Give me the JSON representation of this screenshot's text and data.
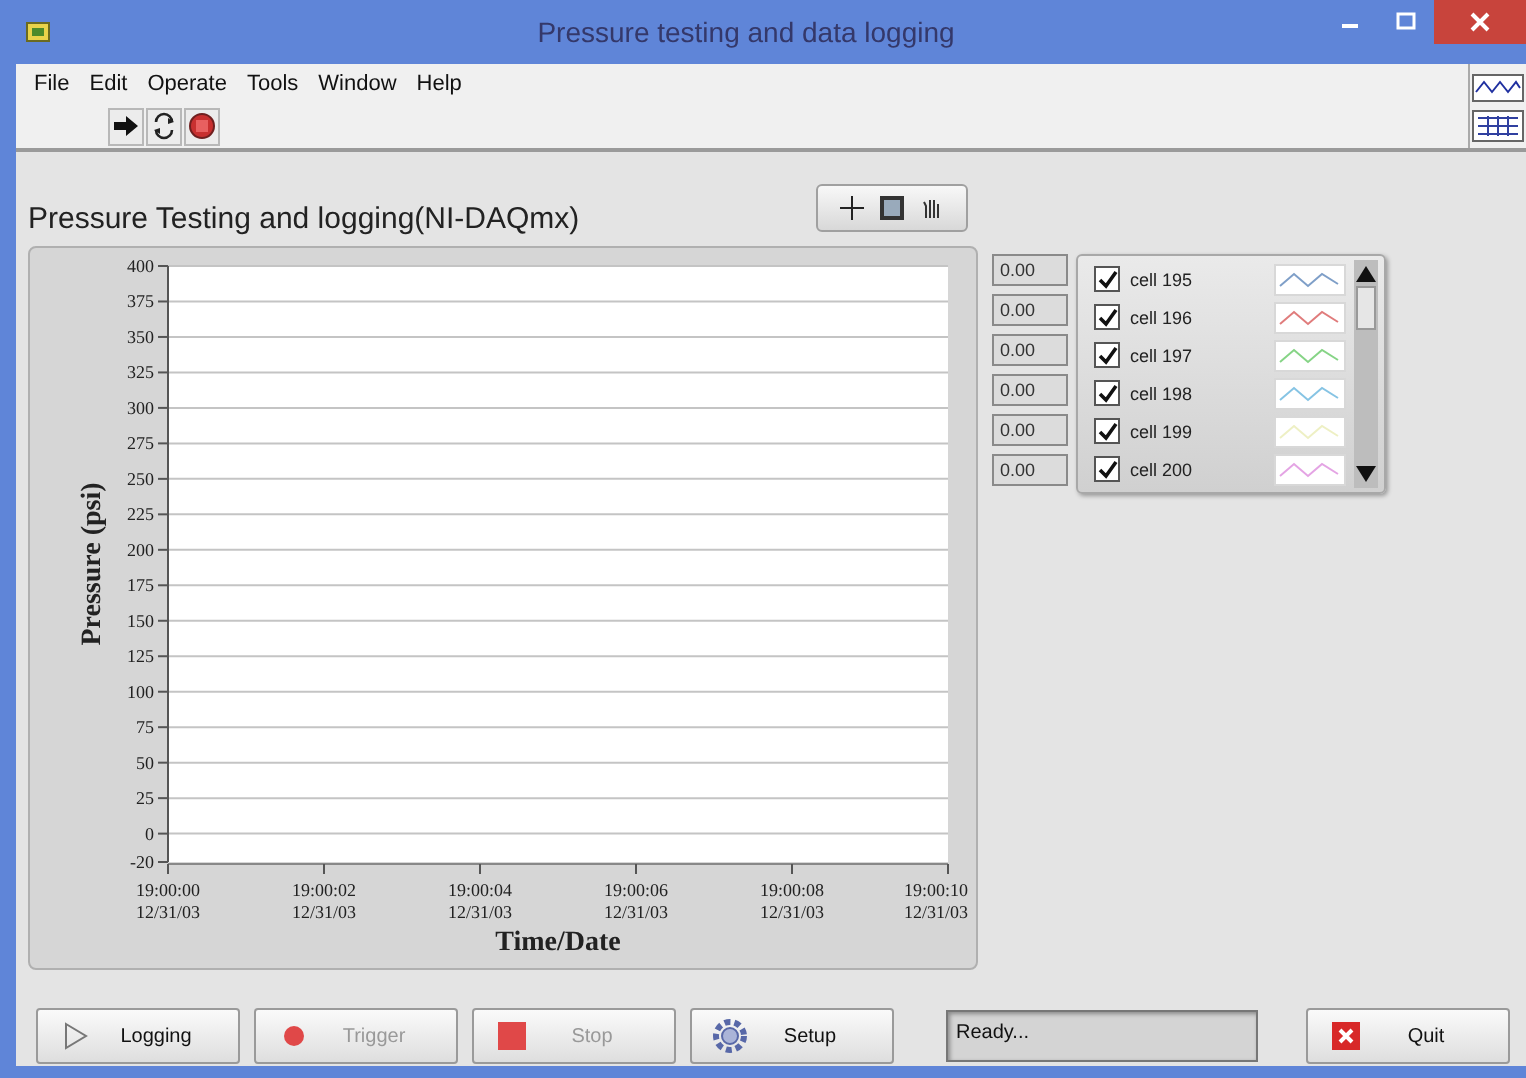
{
  "window": {
    "title": "Pressure testing and data logging"
  },
  "menu": [
    "File",
    "Edit",
    "Operate",
    "Tools",
    "Window",
    "Help"
  ],
  "panel_title": "Pressure Testing and logging(NI-DAQmx)",
  "graph": {
    "chart_data": {
      "type": "line",
      "grid": true,
      "xlabel": "Time/Date",
      "ylabel": "Pressure (psi)",
      "ylim": [
        -20,
        400
      ],
      "yticks": [
        -20,
        0,
        25,
        50,
        75,
        100,
        125,
        150,
        175,
        200,
        225,
        250,
        275,
        300,
        325,
        350,
        375,
        400
      ],
      "categories": [
        "19:00:00 12/31/03",
        "19:00:02 12/31/03",
        "19:00:04 12/31/03",
        "19:00:06 12/31/03",
        "19:00:08 12/31/03",
        "19:00:10 12/31/03"
      ]
    }
  },
  "legend": [
    {
      "name": "cell 195",
      "checked": true,
      "color": "#7f9fc8",
      "value": "0.00"
    },
    {
      "name": "cell 196",
      "checked": true,
      "color": "#e07c7c",
      "value": "0.00"
    },
    {
      "name": "cell 197",
      "checked": true,
      "color": "#86d486",
      "value": "0.00"
    },
    {
      "name": "cell 198",
      "checked": true,
      "color": "#86c4e4",
      "value": "0.00"
    },
    {
      "name": "cell 199",
      "checked": true,
      "color": "#eef0c4",
      "value": "0.00"
    },
    {
      "name": "cell 200",
      "checked": true,
      "color": "#e4a4e4",
      "value": "0.00"
    }
  ],
  "buttons": [
    {
      "label": "Logging",
      "kind": "play",
      "disabled": false
    },
    {
      "label": "Trigger",
      "kind": "dot",
      "disabled": true
    },
    {
      "label": "Stop",
      "kind": "square",
      "disabled": true
    },
    {
      "label": "Setup",
      "kind": "gear",
      "disabled": false
    }
  ],
  "status": "Ready...",
  "quit": {
    "label": "Quit",
    "kind": "close"
  }
}
